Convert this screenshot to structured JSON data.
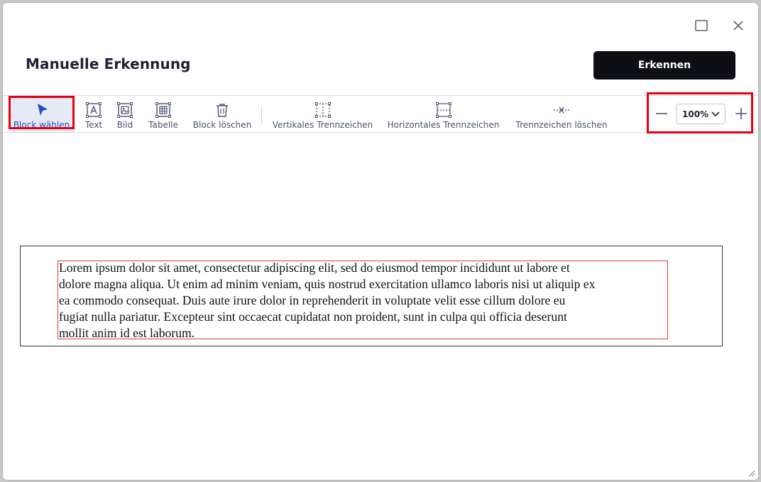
{
  "dialog": {
    "title": "Manuelle Erkennung",
    "primary_button": "Erkennen"
  },
  "toolbar": {
    "tools": [
      {
        "label": "Block wählen",
        "icon": "cursor-arrow-icon",
        "active": true
      },
      {
        "label": "Text",
        "icon": "text-box-icon"
      },
      {
        "label": "Bild",
        "icon": "image-box-icon"
      },
      {
        "label": "Tabelle",
        "icon": "table-box-icon"
      },
      {
        "label": "Block löschen",
        "icon": "trash-icon"
      },
      {
        "label": "Vertikales Trennzeichen",
        "icon": "vertical-separator-icon"
      },
      {
        "label": "Horizontales Trennzeichen",
        "icon": "horizontal-separator-icon"
      },
      {
        "label": "Trennzeichen löschen",
        "icon": "delete-separator-icon"
      }
    ],
    "zoom": {
      "value": "100%"
    }
  },
  "document": {
    "lines": [
      "Lorem ipsum dolor sit amet, consectetur adipiscing elit, sed do eiusmod tempor incididunt ut labore et",
      "dolore magna aliqua. Ut enim ad minim veniam, quis nostrud exercitation ullamco laboris nisi ut aliquip ex",
      "ea commodo consequat. Duis aute irure dolor in reprehenderit in voluptate velit esse cillum dolore eu",
      "fugiat nulla pariatur. Excepteur sint occaecat cupidatat non proident, sunt in culpa qui officia deserunt",
      "mollit anim id est laborum."
    ]
  },
  "colors": {
    "accent": "#1f4fb8",
    "highlight": "#e8000f",
    "primary_button": "#0d0f14",
    "block_border": "#e83a3a"
  }
}
